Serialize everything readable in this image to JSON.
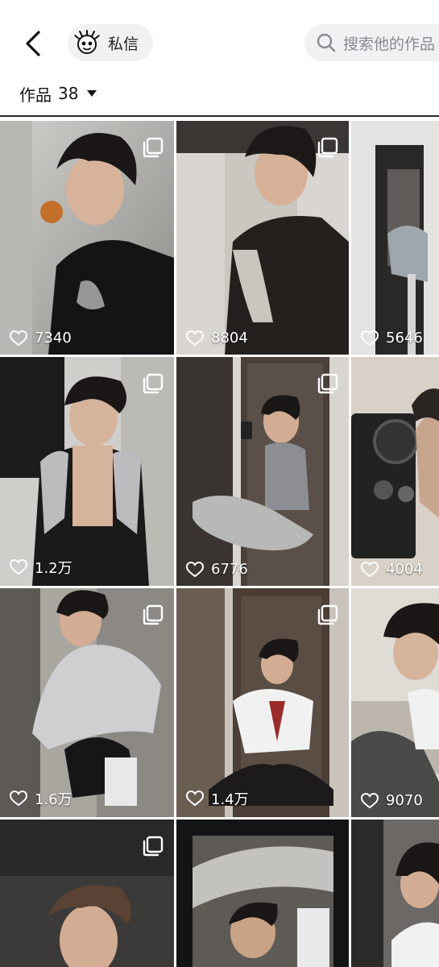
{
  "header": {
    "message_label": "私信",
    "search_placeholder": "搜索他的作品"
  },
  "works_tab": {
    "label": "作品",
    "count": "38"
  },
  "grid": {
    "posts": [
      {
        "likes": "7340",
        "multi": true
      },
      {
        "likes": "8804",
        "multi": true
      },
      {
        "likes": "5646",
        "multi": false
      },
      {
        "likes": "1.2万",
        "multi": true
      },
      {
        "likes": "6776",
        "multi": true
      },
      {
        "likes": "4004",
        "multi": false
      },
      {
        "likes": "1.6万",
        "multi": true
      },
      {
        "likes": "1.4万",
        "multi": true
      },
      {
        "likes": "9070",
        "multi": false
      },
      {
        "likes": "",
        "multi": true
      },
      {
        "likes": "",
        "multi": false
      },
      {
        "likes": "",
        "multi": false
      }
    ]
  },
  "colors": {
    "accent_text": "#161616",
    "pill_bg": "#f1f1f3",
    "placeholder": "#8a8a8f"
  }
}
